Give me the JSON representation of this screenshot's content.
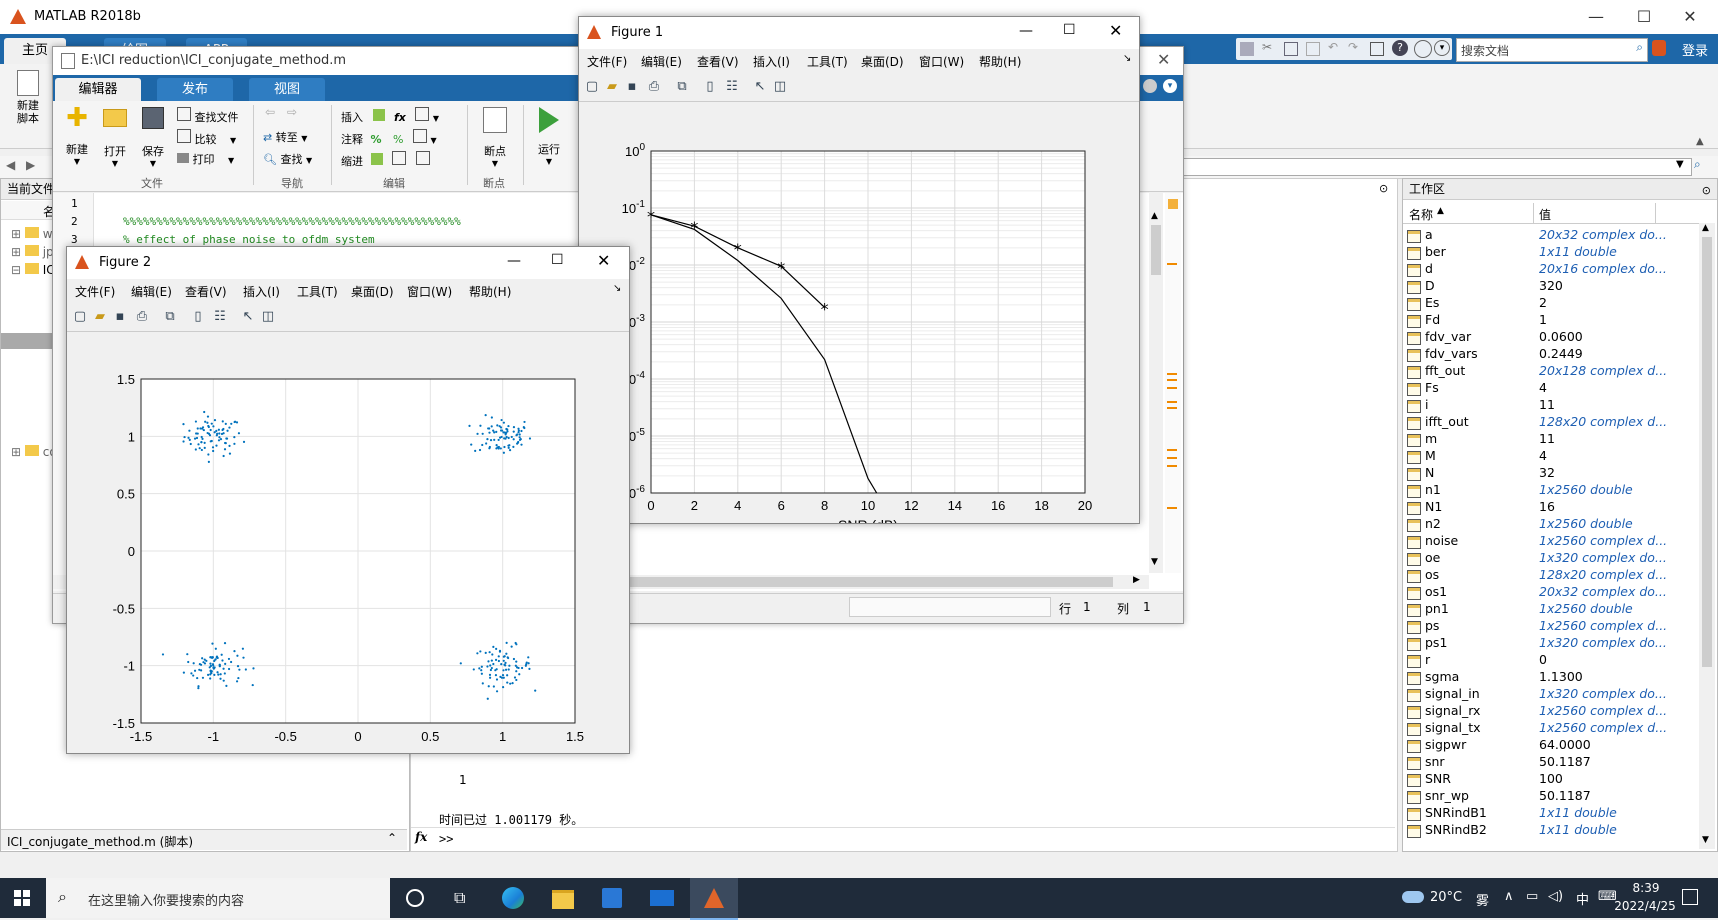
{
  "app": {
    "title": "MATLAB R2018b",
    "login": "登录",
    "search_placeholder": "搜索文档"
  },
  "main_tabs": [
    "主页",
    "绘图",
    "APP"
  ],
  "editor": {
    "path": "E:\\ICI reduction\\ICI_conjugate_method.m",
    "tabs": [
      "编辑器",
      "发布",
      "视图"
    ],
    "groups": {
      "file": "文件",
      "nav": "导航",
      "edit": "编辑",
      "bp": "断点"
    },
    "buttons": {
      "new": "新建",
      "open": "打开",
      "save": "保存",
      "find_files": "查找文件",
      "compare": "比较",
      "print": "打印",
      "goto": "转至",
      "find": "查找",
      "insert": "插入",
      "comment": "注释",
      "indent": "缩进",
      "breakpoints": "断点",
      "run": "运行"
    },
    "new_script": "新建\n脚本",
    "line_numbers": [
      "1",
      "2",
      "3"
    ],
    "code_line_2": "%%%%%%%%%%%%%%%%%%%%%%%%%%%%%%%%%%%%%%%%%%%%%%%%%%%",
    "code_line_3": "% effect of phase noise  to ofdm system",
    "code_sep": "==============================%",
    "status_row": "行",
    "status_row_val": "1",
    "status_col": "列",
    "status_col_val": "1"
  },
  "current_folder": {
    "title": "当前文件夹",
    "col_name": "名",
    "items": [
      "w",
      "jp",
      "IC",
      "co"
    ],
    "footer": "ICI_conjugate_method.m  (脚本)"
  },
  "command_window": {
    "output_1": "1",
    "elapsed": "时间已过 1.001179 秒。",
    "prompt": ">>"
  },
  "workspace": {
    "title": "工作区",
    "col_name": "名称",
    "col_value": "值",
    "rows": [
      {
        "name": "a",
        "value": "20x32 complex do...",
        "italic": true
      },
      {
        "name": "ber",
        "value": "1x11 double",
        "italic": true
      },
      {
        "name": "d",
        "value": "20x16 complex do...",
        "italic": true
      },
      {
        "name": "D",
        "value": "320",
        "italic": false
      },
      {
        "name": "Es",
        "value": "2",
        "italic": false
      },
      {
        "name": "Fd",
        "value": "1",
        "italic": false
      },
      {
        "name": "fdv_var",
        "value": "0.0600",
        "italic": false
      },
      {
        "name": "fdv_vars",
        "value": "0.2449",
        "italic": false
      },
      {
        "name": "fft_out",
        "value": "20x128 complex d...",
        "italic": true
      },
      {
        "name": "Fs",
        "value": "4",
        "italic": false
      },
      {
        "name": "i",
        "value": "11",
        "italic": false
      },
      {
        "name": "ifft_out",
        "value": "128x20 complex d...",
        "italic": true
      },
      {
        "name": "m",
        "value": "11",
        "italic": false
      },
      {
        "name": "M",
        "value": "4",
        "italic": false
      },
      {
        "name": "N",
        "value": "32",
        "italic": false
      },
      {
        "name": "n1",
        "value": "1x2560 double",
        "italic": true
      },
      {
        "name": "N1",
        "value": "16",
        "italic": false
      },
      {
        "name": "n2",
        "value": "1x2560 double",
        "italic": true
      },
      {
        "name": "noise",
        "value": "1x2560 complex d...",
        "italic": true
      },
      {
        "name": "oe",
        "value": "1x320 complex do...",
        "italic": true
      },
      {
        "name": "os",
        "value": "128x20 complex d...",
        "italic": true
      },
      {
        "name": "os1",
        "value": "20x32 complex do...",
        "italic": true
      },
      {
        "name": "pn1",
        "value": "1x2560 double",
        "italic": true
      },
      {
        "name": "ps",
        "value": "1x2560 complex d...",
        "italic": true
      },
      {
        "name": "ps1",
        "value": "1x320 complex do...",
        "italic": true
      },
      {
        "name": "r",
        "value": "0",
        "italic": false
      },
      {
        "name": "sgma",
        "value": "1.1300",
        "italic": false
      },
      {
        "name": "signal_in",
        "value": "1x320 complex do...",
        "italic": true
      },
      {
        "name": "signal_rx",
        "value": "1x2560 complex d...",
        "italic": true
      },
      {
        "name": "signal_tx",
        "value": "1x2560 complex d...",
        "italic": true
      },
      {
        "name": "sigpwr",
        "value": "64.0000",
        "italic": false
      },
      {
        "name": "snr",
        "value": "50.1187",
        "italic": false
      },
      {
        "name": "SNR",
        "value": "100",
        "italic": false
      },
      {
        "name": "snr_wp",
        "value": "50.1187",
        "italic": false
      },
      {
        "name": "SNRindB1",
        "value": "1x11 double",
        "italic": true
      },
      {
        "name": "SNRindB2",
        "value": "1x11 double",
        "italic": true
      }
    ]
  },
  "figure1": {
    "title": "Figure 1",
    "menu": [
      "文件(F)",
      "编辑(E)",
      "查看(V)",
      "插入(I)",
      "工具(T)",
      "桌面(D)",
      "窗口(W)",
      "帮助(H)"
    ]
  },
  "figure2": {
    "title": "Figure 2",
    "menu": [
      "文件(F)",
      "编辑(E)",
      "查看(V)",
      "插入(I)",
      "工具(T)",
      "桌面(D)",
      "窗口(W)",
      "帮助(H)"
    ]
  },
  "chart_data": [
    {
      "type": "line",
      "xlabel": "SNR (dB)",
      "ylabel": "",
      "yscale": "log",
      "xlim": [
        0,
        20
      ],
      "ylim": [
        1e-06,
        1
      ],
      "xticks": [
        "0",
        "2",
        "4",
        "6",
        "8",
        "10",
        "12",
        "14",
        "16",
        "18",
        "20"
      ],
      "yticks": [
        "10^0",
        "10^-1",
        "10^-2",
        "10^-3",
        "10^-4",
        "10^-5",
        "10^-6"
      ],
      "grid": true,
      "series": [
        {
          "marker": "*",
          "x": [
            0,
            2,
            4,
            6,
            8
          ],
          "y": [
            0.076,
            0.048,
            0.02,
            0.0095,
            0.0018
          ]
        },
        {
          "marker": "none",
          "x": [
            0,
            2,
            4,
            6,
            8,
            10,
            10.4
          ],
          "y": [
            0.076,
            0.042,
            0.012,
            0.0026,
            0.00022,
            1.8e-06,
            1e-06
          ]
        }
      ]
    },
    {
      "type": "scatter",
      "xlim": [
        -1.5,
        1.5
      ],
      "ylim": [
        -1.5,
        1.5
      ],
      "xticks": [
        "-1.5",
        "-1",
        "-0.5",
        "0",
        "0.5",
        "1",
        "1.5"
      ],
      "yticks": [
        "1.5",
        "1",
        "0.5",
        "0",
        "-0.5",
        "-1",
        "-1.5"
      ],
      "grid": true,
      "clusters": [
        {
          "cx": -1,
          "cy": 1,
          "spread": 0.1,
          "count": 80
        },
        {
          "cx": 1,
          "cy": 1,
          "spread": 0.1,
          "count": 80
        },
        {
          "cx": -1,
          "cy": -1,
          "spread": 0.1,
          "count": 80
        },
        {
          "cx": 1,
          "cy": -1,
          "spread": 0.1,
          "count": 80
        }
      ],
      "marker_color": "#0072bd"
    }
  ],
  "taskbar": {
    "search_placeholder": "在这里输入你要搜索的内容",
    "weather_temp": "20°C",
    "weather_desc": "雾",
    "ime": "中",
    "time": "8:39",
    "date": "2022/4/25"
  }
}
